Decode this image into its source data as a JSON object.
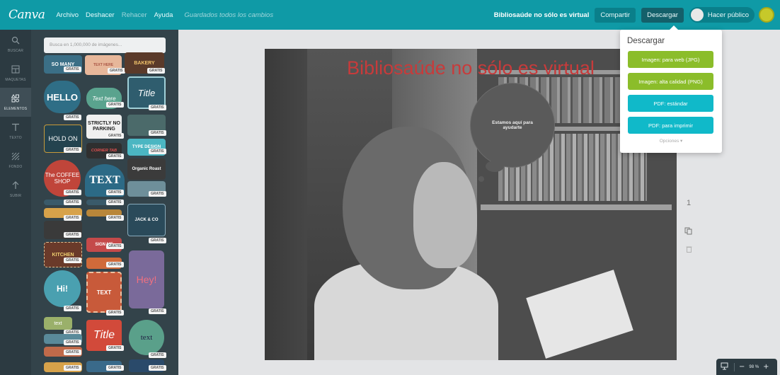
{
  "app": {
    "logo": "Canva",
    "menu": [
      "Archivo",
      "Deshacer",
      "Rehacer",
      "Ayuda"
    ],
    "saved_status": "Guardados todos los cambios",
    "document_title": "Bibliosaúde no sólo es virtual",
    "share_label": "Compartir",
    "download_label": "Descargar",
    "publish_label": "Hacer público"
  },
  "rail": {
    "items": [
      {
        "label": "BUSCAR",
        "icon": "search-icon"
      },
      {
        "label": "MAQUETAS",
        "icon": "layout-icon"
      },
      {
        "label": "ELEMENTOS",
        "icon": "shapes-icon"
      },
      {
        "label": "TEXTO",
        "icon": "text-icon"
      },
      {
        "label": "FONDO",
        "icon": "background-icon"
      },
      {
        "label": "SUBIR",
        "icon": "upload-icon"
      }
    ]
  },
  "panel": {
    "search_placeholder": "Busca en 1,000,000 de imágenes...",
    "badge": "GRATIS",
    "thumb_texts": {
      "so_many": "SO MANY",
      "text_here": "TEXT HERE",
      "bakery": "BAKERY",
      "hello": "HELLO",
      "text_here_script": "Text here",
      "title_script": "Title",
      "strictly": "STRICTLY NO PARKING",
      "hold_on": "HOLD ON",
      "corner_tab": "CORNER TAB",
      "type_design": "TYPE DESIGN",
      "coffee_shop": "The COFFEE SHOP",
      "text_big": "TEXT",
      "organic_roast": "Organic Roast",
      "jack_co": "JACK & CO",
      "sign_me": "SIGN ME",
      "kitchen": "KITCHEN",
      "hi": "Hi!",
      "text_small": "TEXT",
      "hey": "Hey!",
      "text_lower": "text",
      "title_red": "Title",
      "text_round": "text"
    }
  },
  "canvas": {
    "headline": "Bibliosaúde no sólo es virtual",
    "bubble_text": "Estamos aquí para ayudarte",
    "page_number": "1"
  },
  "download_menu": {
    "title": "Descargar",
    "options": [
      {
        "label": "Imagen: para web (JPG)"
      },
      {
        "label": "Imagen: alta calidad (PNG)"
      },
      {
        "label": "PDF: estándar"
      },
      {
        "label": "PDF: para imprimir"
      }
    ],
    "more_label": "Opciones ▾"
  },
  "zoom": {
    "value": "98 %"
  },
  "colors": {
    "topbar": "#0f9aa6",
    "headline": "#c73b3b",
    "green_button": "#8bbd2a",
    "teal_button": "#10b9c9"
  }
}
